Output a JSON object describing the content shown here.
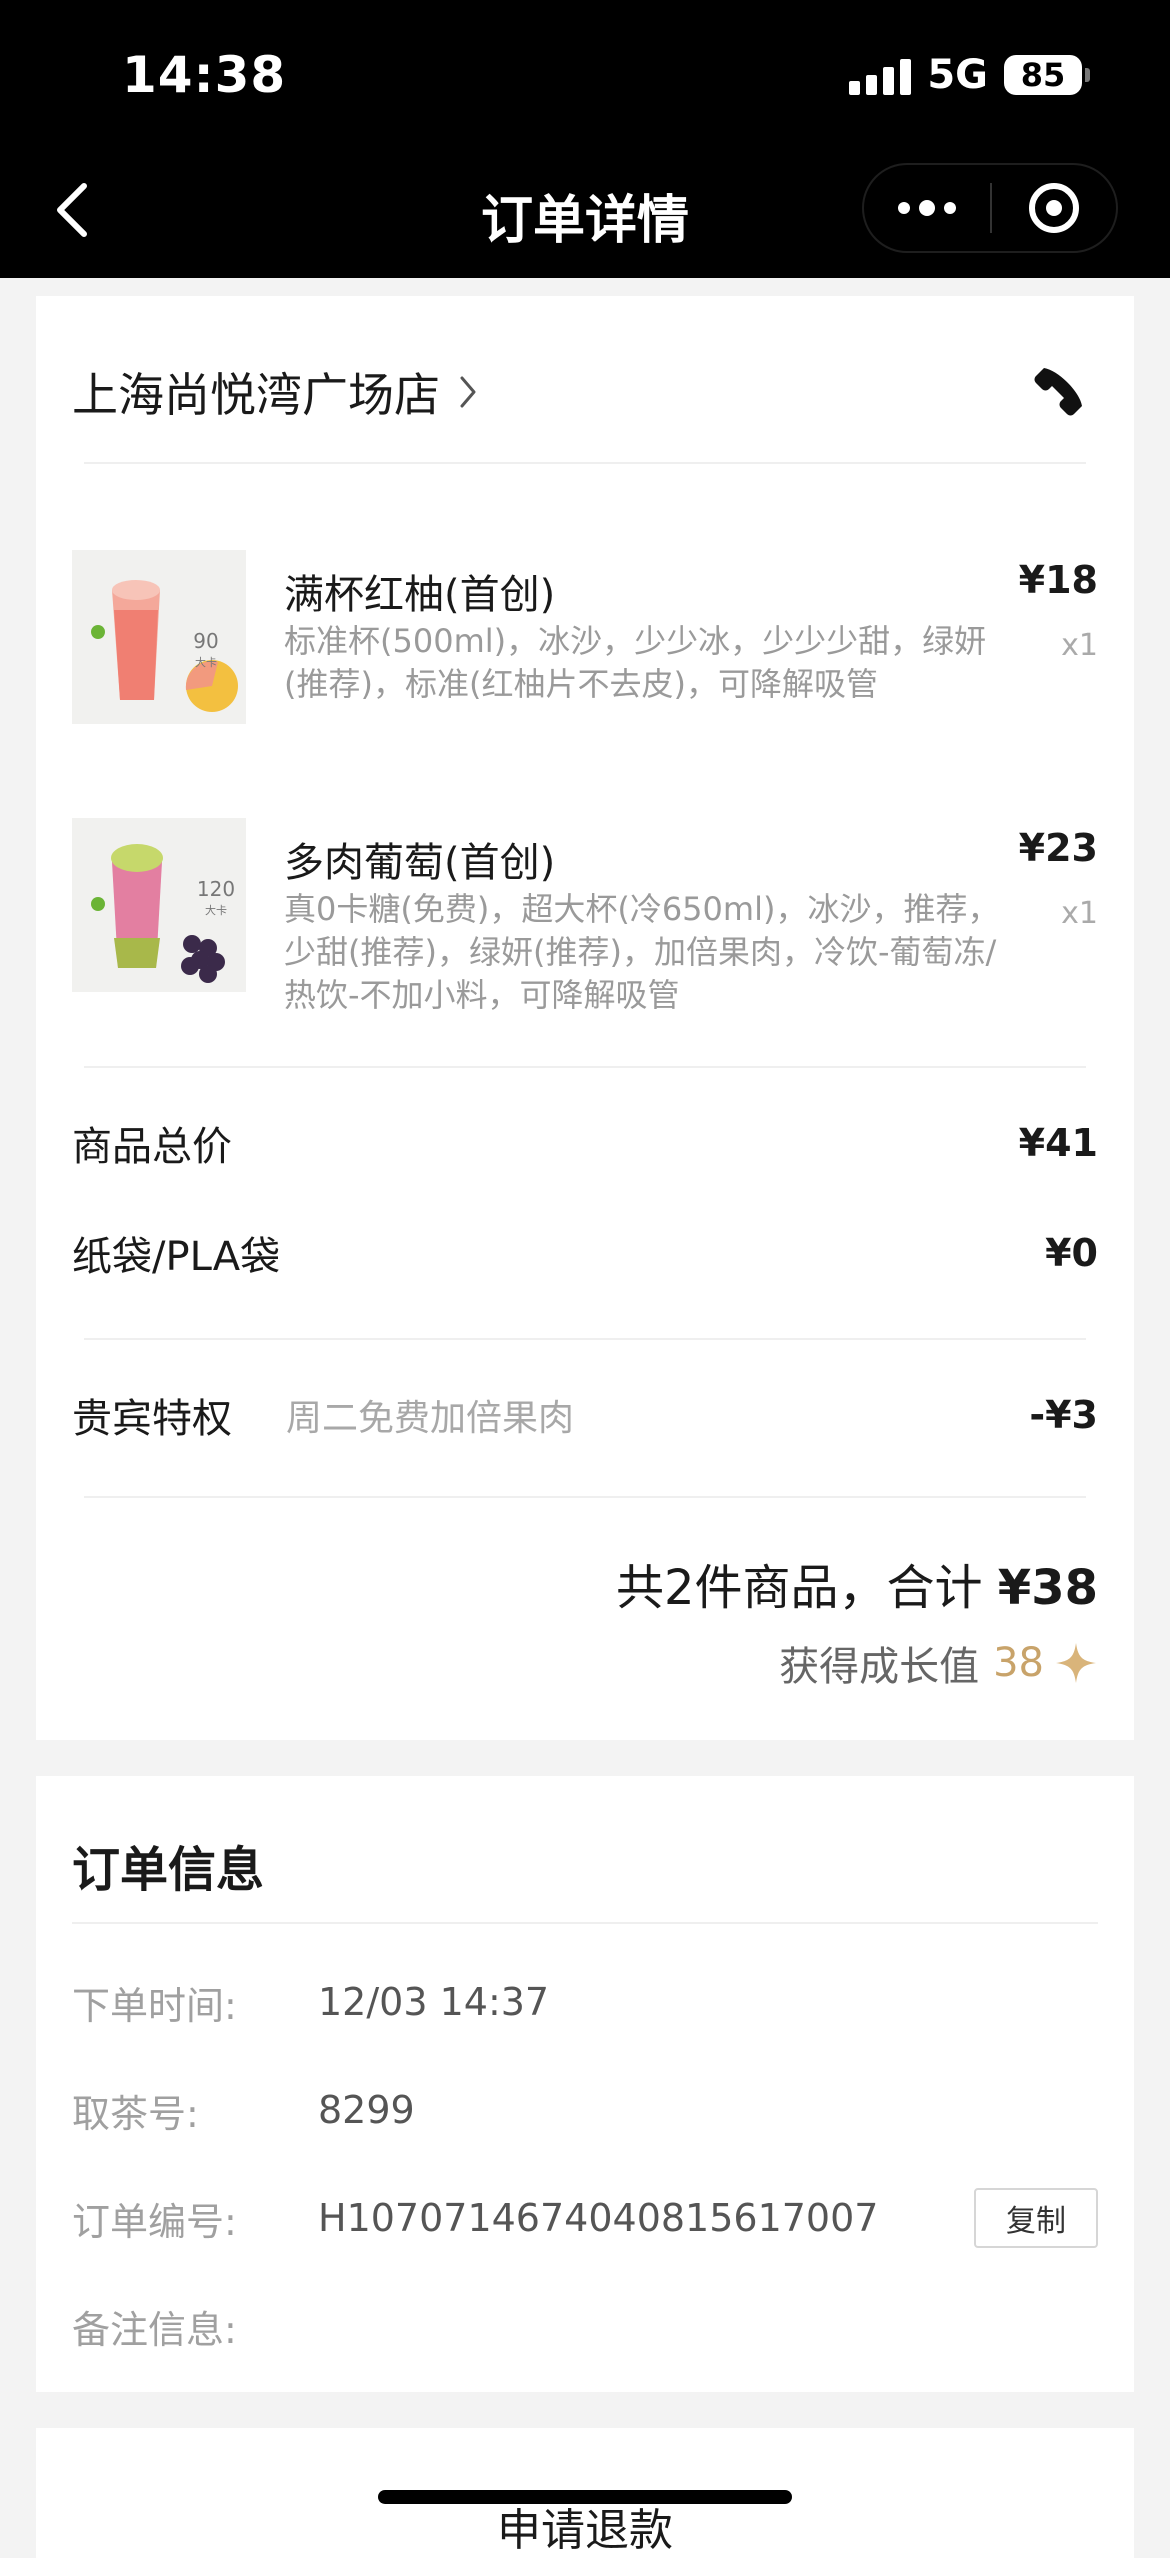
{
  "status": {
    "time": "14:38",
    "network": "5G",
    "battery": "85"
  },
  "nav": {
    "title": "订单详情"
  },
  "store": {
    "name": "上海尚悦湾广场店"
  },
  "items": [
    {
      "name": "满杯红柚(首创)",
      "spec": "标准杯(500ml)，冰沙，少少冰，少少少甜，绿妍(推荐)，标准(红柚片不去皮)，可降解吸管",
      "price": "¥18",
      "qty": "x1",
      "img": {
        "label": "90",
        "sub": "大卡"
      }
    },
    {
      "name": "多肉葡萄(首创)",
      "spec": "真0卡糖(免费)，超大杯(冷650ml)，冰沙，推荐，少甜(推荐)，绿妍(推荐)，加倍果肉，冷饮-葡萄冻/热饮-不加小料，可降解吸管",
      "price": "¥23",
      "qty": "x1",
      "img": {
        "label": "120",
        "sub": "大卡"
      }
    }
  ],
  "summary": {
    "goods_label": "商品总价",
    "goods_value": "¥41",
    "bag_label": "纸袋/PLA袋",
    "bag_value": "¥0",
    "vip_label": "贵宾特权",
    "vip_sub": "周二免费加倍果肉",
    "vip_value": "-¥3",
    "total_prefix": "共2件商品，合计 ",
    "total_value": "¥38",
    "growth_label": "获得成长值",
    "growth_value": "38"
  },
  "order_info": {
    "title": "订单信息",
    "rows": [
      {
        "label": "下单时间:",
        "value": "12/03 14:37"
      },
      {
        "label": "取茶号:",
        "value": "8299"
      },
      {
        "label": "订单编号:",
        "value": "H1070714674040815617007"
      },
      {
        "label": "备注信息:",
        "value": ""
      }
    ],
    "copy_label": "复制"
  },
  "refund_label": "申请退款",
  "colors": {
    "accent_gold": "#c8a36a",
    "topbar": "#000000",
    "background": "#f3f3f3"
  }
}
